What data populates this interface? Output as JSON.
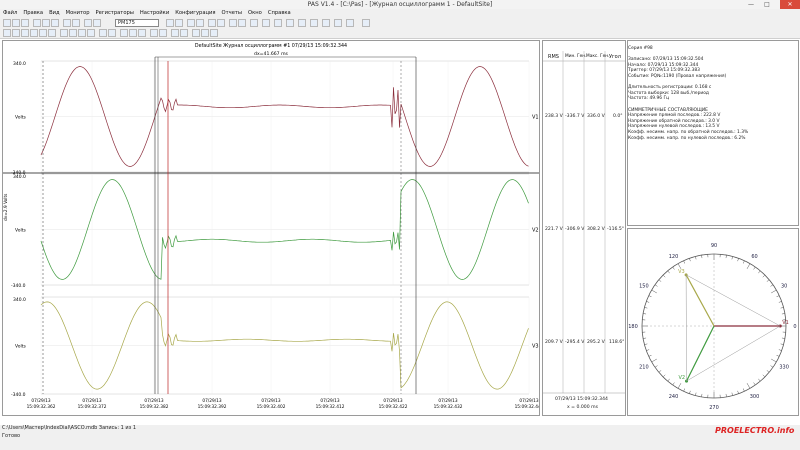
{
  "window": {
    "title": "PAS V1.4 - [C:\\Pas] - [Журнал осциллограмм 1 - DefaultSite]",
    "min": "—",
    "max": "□",
    "close": "✕"
  },
  "menu": [
    "Файл",
    "Правка",
    "Вид",
    "Монитор",
    "Регистраторы",
    "Настройки",
    "Конфигурация",
    "Отчеты",
    "Окно",
    "Справка"
  ],
  "toolbar": {
    "device": "PM175"
  },
  "plot": {
    "title": "DefaultSite  Журнал осциллограмм #1    07/29/13   15:09:32.344",
    "dx": "dx=41.667 ms",
    "axis_label": "dv=2.9 Volts",
    "channels": [
      {
        "name": "V1",
        "unit": "Volts",
        "top": "340.0",
        "bottom": "-340.0",
        "color": "#8b2e3c"
      },
      {
        "name": "V2",
        "unit": "Volts",
        "top": "340.0",
        "bottom": "-340.0",
        "color": "#3e9a3e"
      },
      {
        "name": "V3",
        "unit": "Volts",
        "top": "340.0",
        "bottom": "-340.0",
        "color": "#a8a84a"
      }
    ],
    "x_ticks": [
      [
        "07/29/13",
        "15:09:32.362"
      ],
      [
        "07/29/13",
        "15:09:32.372"
      ],
      [
        "07/29/13",
        "15:09:32.382"
      ],
      [
        "07/29/13",
        "15:09:32.392"
      ],
      [
        "07/29/13",
        "15:09:32.402"
      ],
      [
        "07/29/13",
        "15:09:32.412"
      ],
      [
        "07/29/13",
        "15:09:32.422"
      ],
      [
        "07/29/13",
        "15:09:32.432"
      ],
      [
        "07/29/13",
        "15:09:32.442"
      ]
    ]
  },
  "table": {
    "headers": [
      "RMS",
      "Мин. Ген.",
      "Макс. Ген.",
      "Угол"
    ],
    "rows": [
      [
        "238.3 V",
        "-336.7 V",
        "336.0 V",
        "0.0°"
      ],
      [
        "221.7 V",
        "-306.9 V",
        "308.2 V",
        "-116.5°"
      ],
      [
        "209.7 V",
        "-295.4 V",
        "295.2 V",
        "118.6°"
      ]
    ],
    "footer_time": "07/29/13  15:09:32.344",
    "footer_x": "x = 0.000 ms"
  },
  "info": {
    "lines": [
      "Серия #98",
      "",
      "Записано: 07/29/13  15:09:32.504",
      "Начало:   07/29/13  15:09:32.344",
      "Триггер:  07/29/13  15:09:32.383",
      "Событие: РQ№:1190 (Провал напряжения)",
      "",
      "Длительность регистрации: 0.168 с",
      "Частота выборки: 128 выб./период",
      "Частота: 49.96 Гц",
      "",
      "СИММЕТРИЧНЫЕ СОСТАВЛЯЮЩИЕ",
      "Напряжение прямой последов.: 222.8 V",
      "Напряжение обратной последов.: 3.0 V",
      "Напряжение нулевой последов.: 13.5 V",
      "Коэфф. несимм. напр. по обратной последов.: 1.3%",
      "Коэфф. несимм. напр. по нулевой последов.: 6.2%"
    ]
  },
  "phasor": {
    "labels": [
      "0",
      "30",
      "60",
      "90",
      "120",
      "150",
      "180",
      "210",
      "240",
      "270",
      "300",
      "330"
    ],
    "vectors": [
      {
        "name": "V1",
        "angle": 0,
        "mag": 1.0,
        "color": "#8b2e3c"
      },
      {
        "name": "V2",
        "angle": -116.5,
        "mag": 0.93,
        "color": "#3e9a3e"
      },
      {
        "name": "V3",
        "angle": 118.6,
        "mag": 0.88,
        "color": "#a8a84a"
      }
    ]
  },
  "status": {
    "path": "C:\\Users\\Мастер\\IndexDial\\ASCO.mdb  Запись: 1 из 1",
    "ready": "Готово"
  },
  "watermark": "PROELECTRO.info"
}
